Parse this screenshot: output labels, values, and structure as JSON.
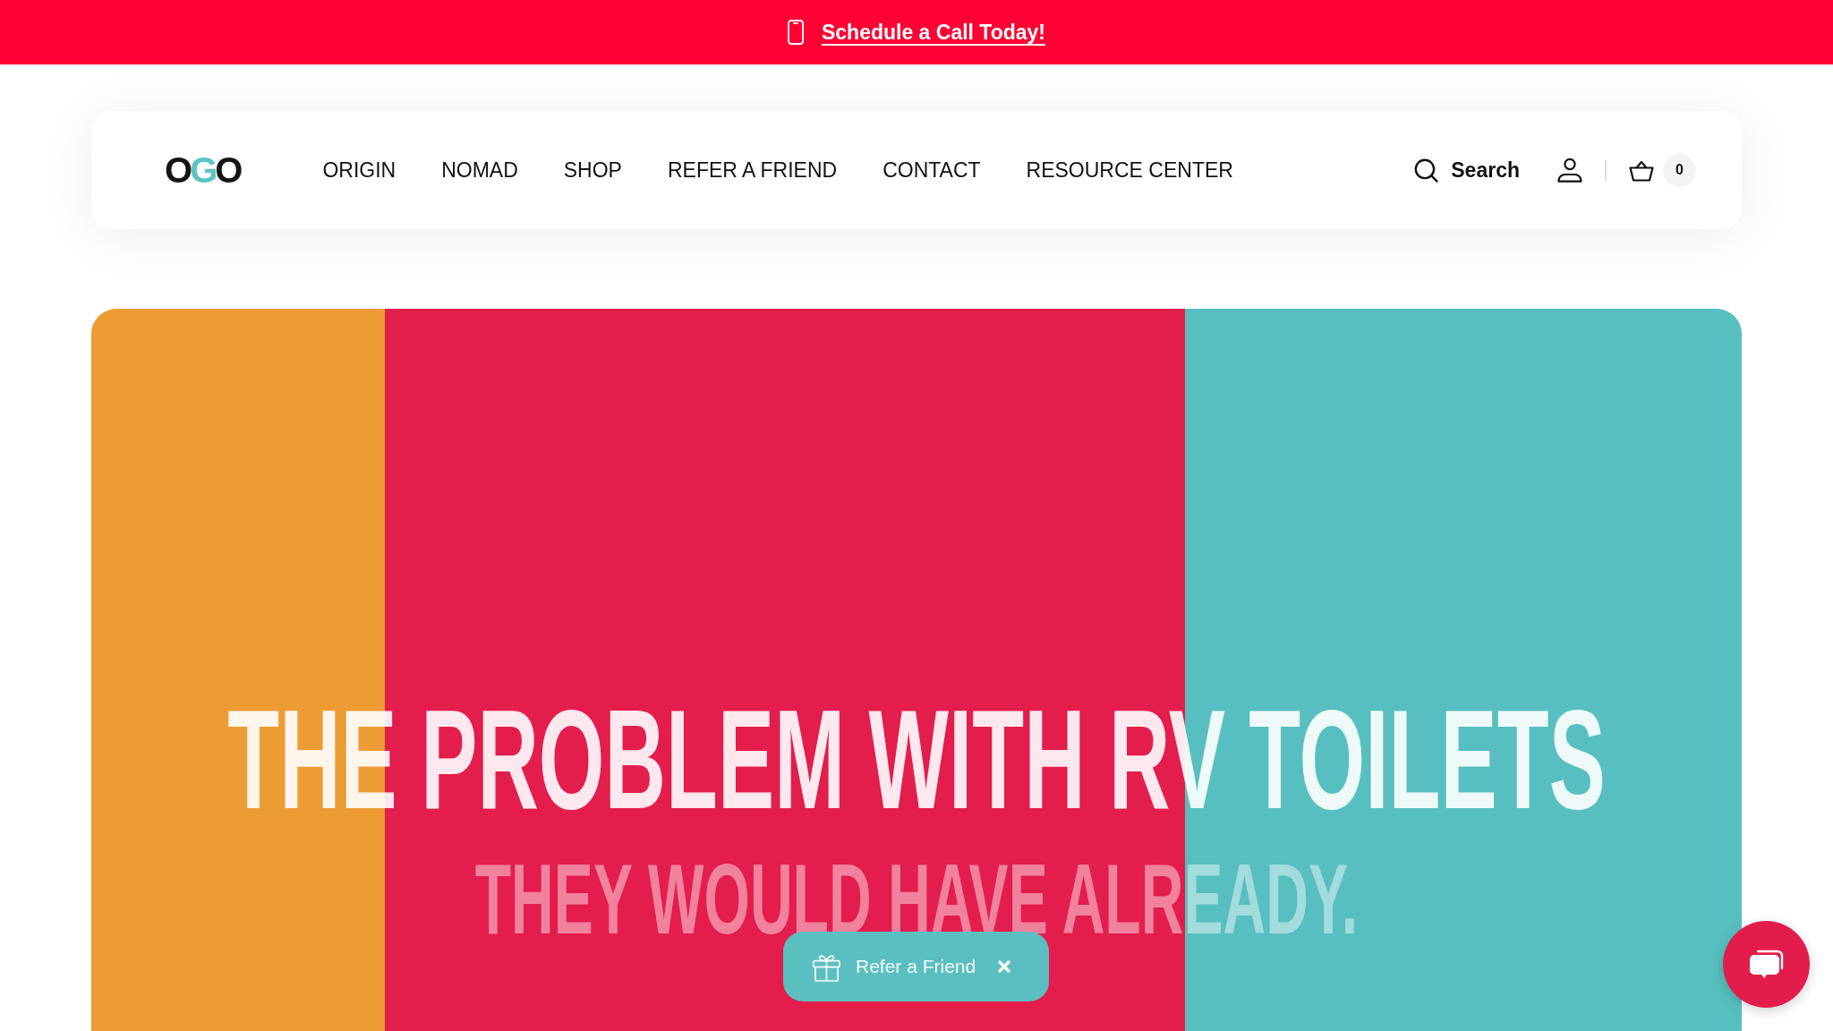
{
  "announcement_bar": {
    "link": "Schedule a Call Today!"
  },
  "header": {
    "logo": "OGO",
    "nav": [
      {
        "label": "ORIGIN"
      },
      {
        "label": "NOMAD"
      },
      {
        "label": "SHOP"
      },
      {
        "label": "REFER A FRIEND"
      },
      {
        "label": "CONTACT"
      },
      {
        "label": "RESOURCE CENTER"
      }
    ],
    "search": {
      "label": "Search"
    },
    "cart": {
      "count": "0"
    }
  },
  "hero": {
    "headline": "THE PROBLEM WITH RV TOILETS",
    "subheadline": "THEY WOULD HAVE ALREADY."
  },
  "refer_popup": {
    "label": "Refer a Friend"
  }
}
